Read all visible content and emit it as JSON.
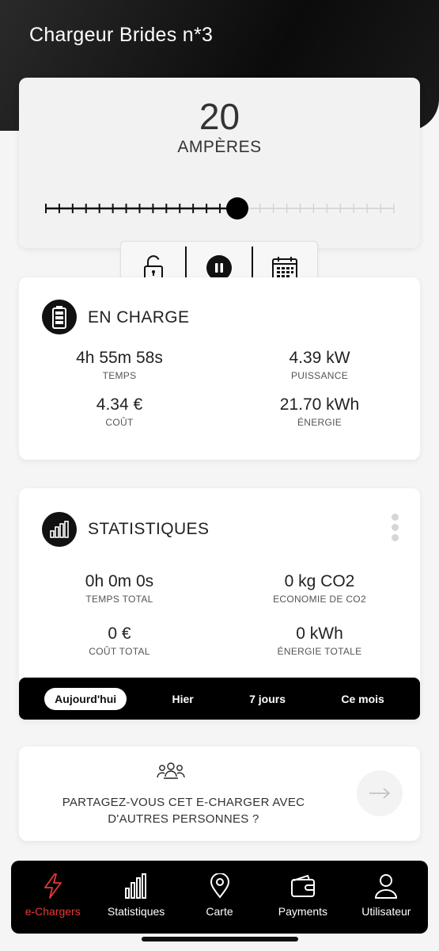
{
  "header": {
    "title": "Chargeur Brides n*3"
  },
  "amperage": {
    "value": "20",
    "unit": "AMPÈRES",
    "level_fraction": 0.55
  },
  "controls": {
    "icons": [
      "unlock-icon",
      "pause-icon",
      "calendar-icon"
    ]
  },
  "charging": {
    "title": "EN CHARGE",
    "stats": [
      {
        "value": "4h 55m 58s",
        "label": "TEMPS"
      },
      {
        "value": "4.39 kW",
        "label": "PUISSANCE"
      },
      {
        "value": "4.34 €",
        "label": "COÛT"
      },
      {
        "value": "21.70 kWh",
        "label": "ÉNERGIE"
      }
    ]
  },
  "statistics": {
    "title": "STATISTIQUES",
    "stats": [
      {
        "value": "0h 0m 0s",
        "label": "TEMPS TOTAL"
      },
      {
        "value": "0 kg CO2",
        "label": "ECONOMIE DE CO2"
      },
      {
        "value": "0 €",
        "label": "COÛT TOTAL"
      },
      {
        "value": "0 kWh",
        "label": "ÉNERGIE TOTALE"
      }
    ],
    "periods": [
      "Aujourd'hui",
      "Hier",
      "7 jours",
      "Ce mois"
    ],
    "active_period": "Aujourd'hui"
  },
  "share": {
    "text": "PARTAGEZ-VOUS CET E-CHARGER AVEC D'AUTRES PERSONNES ?"
  },
  "nav": {
    "items": [
      {
        "label": "e-Chargers",
        "icon": "bolt-icon"
      },
      {
        "label": "Statistiques",
        "icon": "bar-chart-icon"
      },
      {
        "label": "Carte",
        "icon": "map-pin-icon"
      },
      {
        "label": "Payments",
        "icon": "wallet-icon"
      },
      {
        "label": "Utilisateur",
        "icon": "user-icon"
      }
    ],
    "active": "e-Chargers"
  },
  "colors": {
    "accent": "#e53935",
    "dark": "#000000"
  }
}
